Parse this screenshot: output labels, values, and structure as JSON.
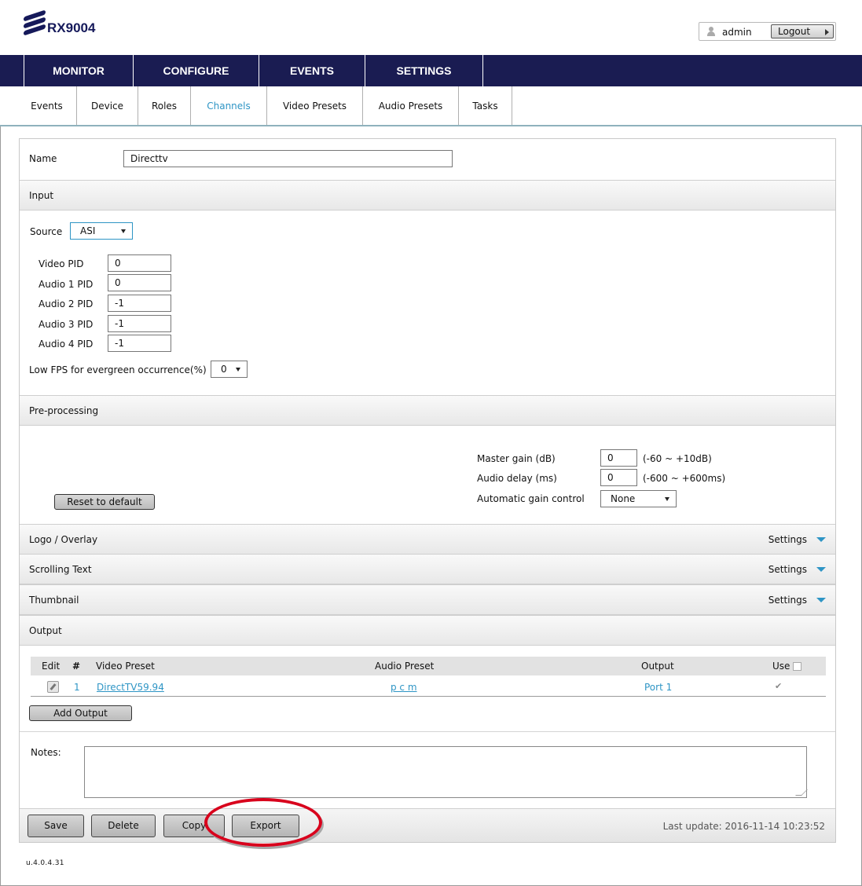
{
  "app": {
    "title": "RX9004"
  },
  "user": {
    "name": "admin",
    "logout_label": "Logout"
  },
  "main_nav": [
    "MONITOR",
    "CONFIGURE",
    "EVENTS",
    "SETTINGS"
  ],
  "sub_nav": [
    "Events",
    "Device",
    "Roles",
    "Channels",
    "Video Presets",
    "Audio Presets",
    "Tasks"
  ],
  "sub_nav_active": "Channels",
  "name_field": {
    "label": "Name",
    "value": "Directtv"
  },
  "input_section": {
    "title": "Input",
    "source_label": "Source",
    "source_value": "ASI",
    "pids": [
      {
        "label": "Video PID",
        "value": "0"
      },
      {
        "label": "Audio 1 PID",
        "value": "0"
      },
      {
        "label": "Audio 2 PID",
        "value": "-1"
      },
      {
        "label": "Audio 3 PID",
        "value": "-1"
      },
      {
        "label": "Audio 4 PID",
        "value": "-1"
      }
    ],
    "low_fps_label": "Low FPS for evergreen occurrence(%)",
    "low_fps_value": "0"
  },
  "preprocessing": {
    "title": "Pre-processing",
    "reset_label": "Reset to default",
    "master_gain_label": "Master gain (dB)",
    "master_gain_value": "0",
    "master_gain_range": "(-60 ~ +10dB)",
    "audio_delay_label": "Audio delay (ms)",
    "audio_delay_value": "0",
    "audio_delay_range": "(-600 ~ +600ms)",
    "agc_label": "Automatic gain control",
    "agc_value": "None"
  },
  "collapsed_sections": [
    {
      "title": "Logo / Overlay",
      "settings": "Settings"
    },
    {
      "title": "Scrolling Text",
      "settings": "Settings"
    },
    {
      "title": "Thumbnail",
      "settings": "Settings"
    }
  ],
  "output": {
    "title": "Output",
    "columns": {
      "edit": "Edit",
      "num": "#",
      "video": "Video Preset",
      "audio": "Audio Preset",
      "output": "Output",
      "use": "Use"
    },
    "rows": [
      {
        "num": "1",
        "video": "DirectTV59.94",
        "audio": "p c m",
        "output": "Port 1",
        "use": true
      }
    ],
    "add_label": "Add Output"
  },
  "notes": {
    "label": "Notes:",
    "value": ""
  },
  "footer": {
    "save": "Save",
    "delete": "Delete",
    "copy": "Copy",
    "export": "Export",
    "last_update": "Last update: 2016-11-14 10:23:52"
  },
  "version": "u.4.0.4.31",
  "colors": {
    "nav_bg": "#1a1c52",
    "accent": "#2e95c5",
    "highlight_ring": "#d8001c"
  }
}
